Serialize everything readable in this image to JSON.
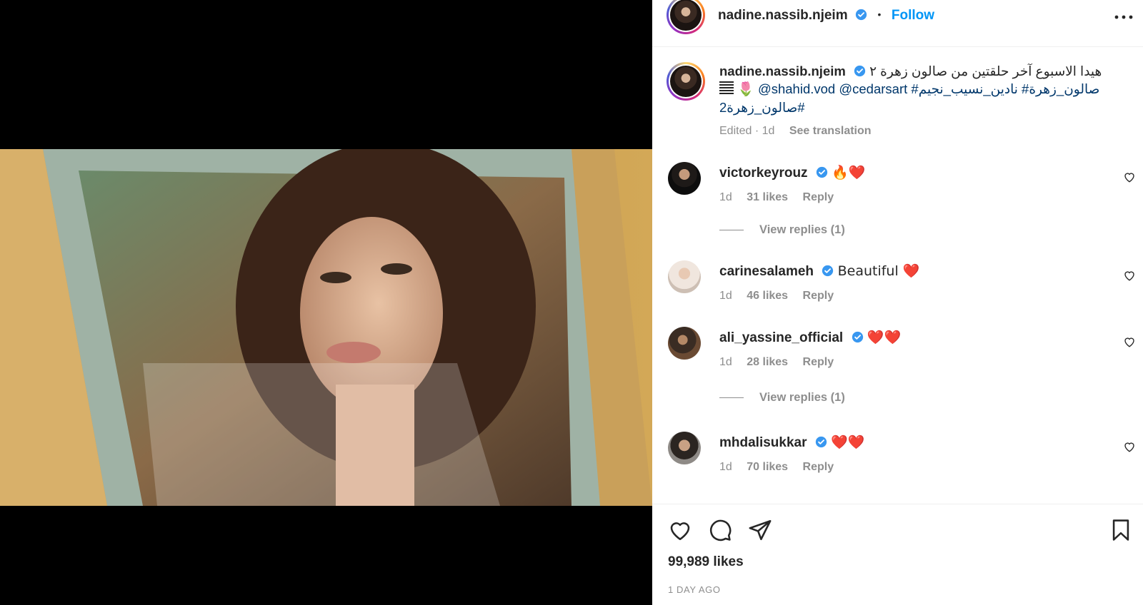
{
  "post": {
    "author": "nadine.nassib.njeim",
    "follow_label": "Follow",
    "separator": "•",
    "caption_text_line1": "هيدا الاسبوع آخر حلقتين من صالون زهرة ٢",
    "caption_emoji": "🌷",
    "caption_mentions": "@shahid.vod @cedarsart #صالون_زهرة# نادين_نسيب_نجيم",
    "caption_tag2": "#صالون_زهرة2",
    "edited": "Edited · 1d",
    "see_translation": "See translation",
    "likes": "99,989 likes",
    "date": "1 DAY AGO"
  },
  "comments": [
    {
      "user": "victorkeyrouz",
      "text": "🔥❤️",
      "age": "1d",
      "likes": "31 likes",
      "reply": "Reply",
      "replies": "View replies (1)"
    },
    {
      "user": "carinesalameh",
      "text": "Beautiful ❤️",
      "age": "1d",
      "likes": "46 likes",
      "reply": "Reply"
    },
    {
      "user": "ali_yassine_official",
      "text": "❤️❤️",
      "age": "1d",
      "likes": "28 likes",
      "reply": "Reply",
      "replies": "View replies (1)"
    },
    {
      "user": "mhdalisukkar",
      "text": "❤️❤️",
      "age": "1d",
      "likes": "70 likes",
      "reply": "Reply"
    }
  ],
  "icons": {
    "like": "heart-icon",
    "comment": "comment-icon",
    "share": "paper-plane-icon",
    "save": "bookmark-icon",
    "more": "more-options-icon",
    "verified": "verified-badge-icon"
  },
  "colors": {
    "accent": "#0095f6",
    "link": "#00376b",
    "muted": "#8e8e8e",
    "verified": "#3897f0"
  }
}
